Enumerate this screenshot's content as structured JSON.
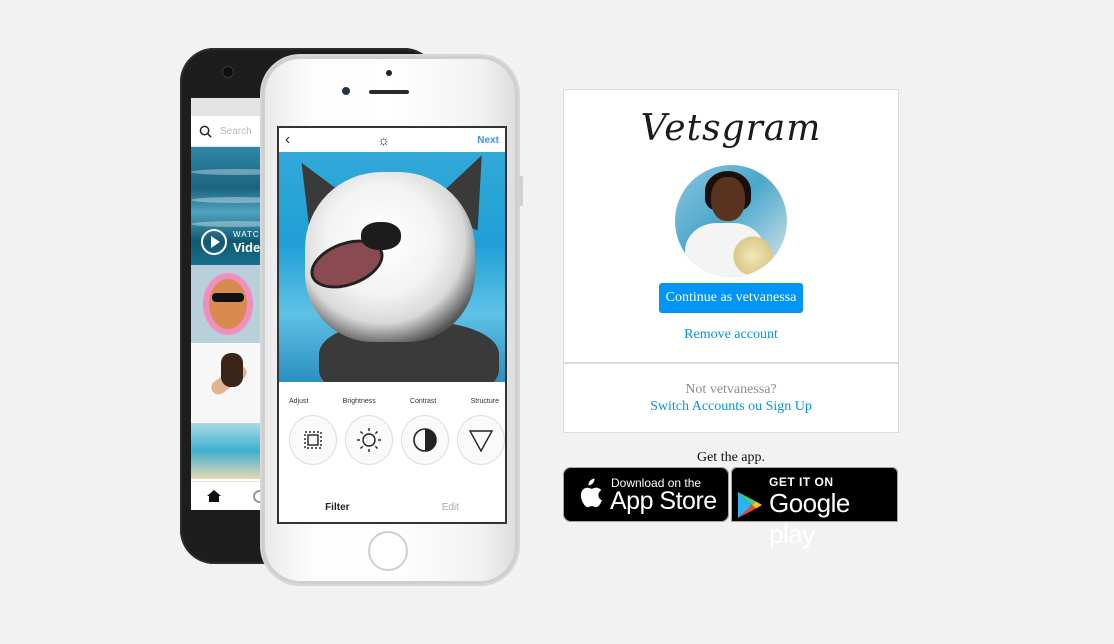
{
  "brand": {
    "logo_text": "Vetsgram"
  },
  "account": {
    "username": "vetvanessa",
    "continue_label": "Continue as vetvanessa",
    "remove_label": "Remove account"
  },
  "switch_panel": {
    "not_user_text": "Not vetvanessa?",
    "switch_label": "Switch Accounts ou Sign Up"
  },
  "app_download": {
    "prompt": "Get the app.",
    "app_store": {
      "small": "Download on the",
      "big": "App Store"
    },
    "google_play": {
      "small": "GET IT ON",
      "big": "Google play"
    }
  },
  "phone_preview": {
    "back_phone": {
      "search_placeholder": "Search",
      "watch_small": "WATCH",
      "watch_big": "Video"
    },
    "front_phone": {
      "next_label": "Next",
      "tools": [
        "Adjust",
        "Brightness",
        "Contrast",
        "Structure"
      ],
      "tabs": [
        "Filter",
        "Edit"
      ]
    }
  },
  "colors": {
    "accent": "#0095f6",
    "muted_text": "#8e8e8e",
    "border": "#dbdbdb",
    "background": "#f2f2f2"
  }
}
